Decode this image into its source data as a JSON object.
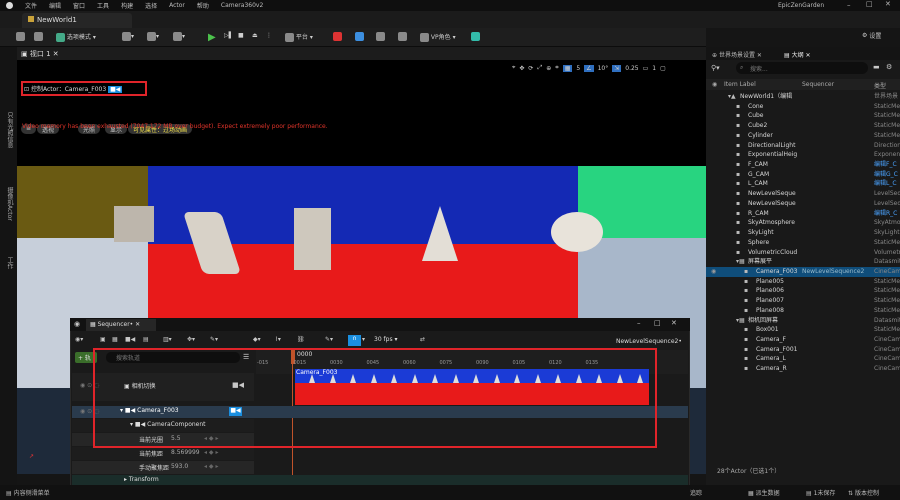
{
  "menu": [
    "文件",
    "编辑",
    "窗口",
    "工具",
    "构建",
    "选择",
    "Actor",
    "帮助",
    "Camera360v2"
  ],
  "project_name": "EpicZenGarden",
  "doc_tab": "NewWorld1",
  "toolbar": {
    "mode": "选项模式",
    "platform": "平台",
    "vp_role": "VP角色",
    "settings": "设置"
  },
  "left_strip": [
    "只有光照信息",
    "摄像机Actor",
    "工作"
  ],
  "viewport": {
    "tab": "视口 1",
    "btn_perspective": "透视",
    "btn_lit": "光照",
    "btn_show": "显示",
    "btn_visible": "可见属性：过场动画",
    "pilot_label": "控制Actor：Camera_F003",
    "warning": "Video memory has been exhausted (7047.172 MB over budget). Expect extremely poor performance.",
    "grid_value": "5",
    "angle_value": "10°",
    "scale_value": "0.25",
    "cam_speed": "1"
  },
  "outliner": {
    "tab_settings": "世界场景设置",
    "tab_outline": "大纲",
    "search_placeholder": "搜索...",
    "col_label": "Item Label",
    "col_seq": "Sequencer",
    "col_type": "类型",
    "rows": [
      {
        "label": "NewWorld1（编辑",
        "type": "世界场景",
        "indent": 0
      },
      {
        "label": "Cone",
        "type": "StaticMe",
        "indent": 1
      },
      {
        "label": "Cube",
        "type": "StaticMe",
        "indent": 1
      },
      {
        "label": "Cube2",
        "type": "StaticMe",
        "indent": 1
      },
      {
        "label": "Cylinder",
        "type": "StaticMe",
        "indent": 1
      },
      {
        "label": "DirectionalLight",
        "type": "Direction",
        "indent": 1
      },
      {
        "label": "ExponentialHeig",
        "type": "Exponent",
        "indent": 1
      },
      {
        "label": "F_CAM",
        "type": "编辑F_C",
        "indent": 1
      },
      {
        "label": "G_CAM",
        "type": "编辑G_C",
        "indent": 1
      },
      {
        "label": "L_CAM",
        "type": "编辑L_C",
        "indent": 1
      },
      {
        "label": "NewLevelSeque",
        "type": "LevelSeq",
        "indent": 1
      },
      {
        "label": "NewLevelSeque",
        "type": "LevelSeq",
        "indent": 1
      },
      {
        "label": "R_CAM",
        "type": "编辑R_C",
        "indent": 1
      },
      {
        "label": "SkyAtmosphere",
        "type": "SkyAtmo",
        "indent": 1
      },
      {
        "label": "SkyLight",
        "type": "SkyLight",
        "indent": 1
      },
      {
        "label": "Sphere",
        "type": "StaticMe",
        "indent": 1
      },
      {
        "label": "VolumetricCloud",
        "type": "Volumetr",
        "indent": 1
      },
      {
        "label": "屏幕展平",
        "type": "Datasmit",
        "indent": 1
      },
      {
        "label": "Camera_F003",
        "type": "CineCam",
        "indent": 2,
        "seq": "NewLevelSequence2",
        "selected": true
      },
      {
        "label": "Plane005",
        "type": "StaticMe",
        "indent": 2
      },
      {
        "label": "Plane006",
        "type": "StaticMe",
        "indent": 2
      },
      {
        "label": "Plane007",
        "type": "StaticMe",
        "indent": 2
      },
      {
        "label": "Plane008",
        "type": "StaticMe",
        "indent": 2
      },
      {
        "label": "相机回屏幕",
        "type": "Datasmit",
        "indent": 1
      },
      {
        "label": "Box001",
        "type": "StaticMe",
        "indent": 2
      },
      {
        "label": "Camera_F",
        "type": "CineCam",
        "indent": 2
      },
      {
        "label": "Camera_F001",
        "type": "CineCam",
        "indent": 2
      },
      {
        "label": "Camera_L",
        "type": "CineCam",
        "indent": 2
      },
      {
        "label": "Camera_R",
        "type": "CineCam",
        "indent": 2
      }
    ],
    "footer": "28个Actor（已选1个）"
  },
  "sequencer": {
    "tab": "Sequencer•",
    "fps": "30 fps",
    "seq_name": "NewLevelSequence2•",
    "search_placeholder": "搜索轨道",
    "add_label": "+ 轨",
    "current_frame": "0000",
    "ticks": [
      "-015",
      "0015",
      "0030",
      "0045",
      "0060",
      "0075",
      "0090",
      "0105",
      "0120",
      "0135"
    ],
    "tracks": {
      "camera_cut": "相机切换",
      "camera_actor": "Camera_F003",
      "component": "CameraComponent",
      "focal_label": "当前光圈",
      "focal_value": "5.5",
      "focal_len_label": "当前焦距",
      "focal_len_value": "8.569999",
      "manual_label": "手动聚焦距",
      "manual_value": "593.0",
      "transform": "Transform"
    },
    "clip_label": "Camera_F003"
  },
  "status": {
    "content": "内容侧滑菜单",
    "trace": "追踪",
    "derived": "派生数据",
    "unsaved": "1未保存",
    "source": "版本控制"
  },
  "colors": {
    "selection": "#0f4d7a",
    "highlight_red": "#e0242a",
    "accent_blue": "#1a8fe0"
  }
}
